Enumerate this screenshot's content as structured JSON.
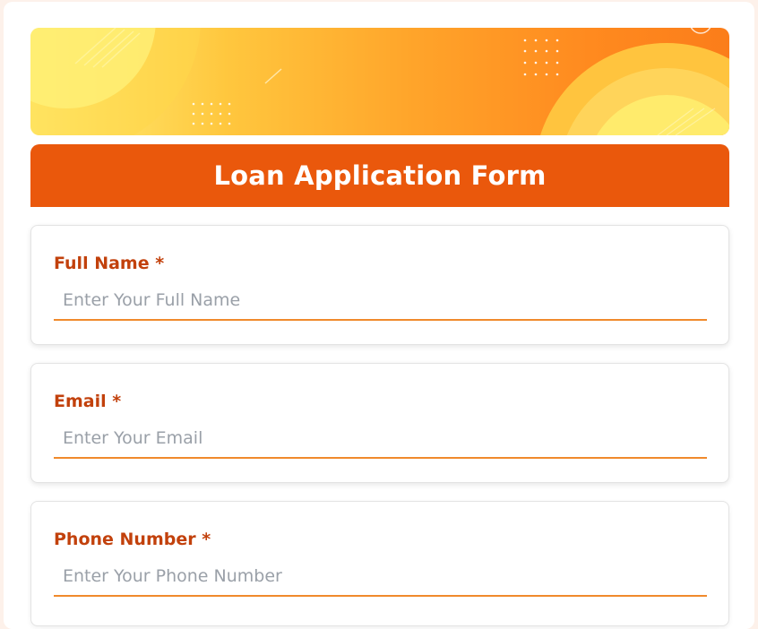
{
  "form": {
    "title": "Loan Application Form",
    "colors": {
      "header": "#ea580c",
      "label": "#c2410c",
      "underline": "#f08a2c",
      "banner_start": "#fff27a",
      "banner_end": "#fb7d1a"
    },
    "fields": [
      {
        "label": "Full Name *",
        "placeholder": "Enter Your Full Name",
        "value": ""
      },
      {
        "label": "Email *",
        "placeholder": "Enter Your Email",
        "value": ""
      },
      {
        "label": "Phone Number *",
        "placeholder": "Enter Your Phone Number",
        "value": ""
      }
    ]
  }
}
